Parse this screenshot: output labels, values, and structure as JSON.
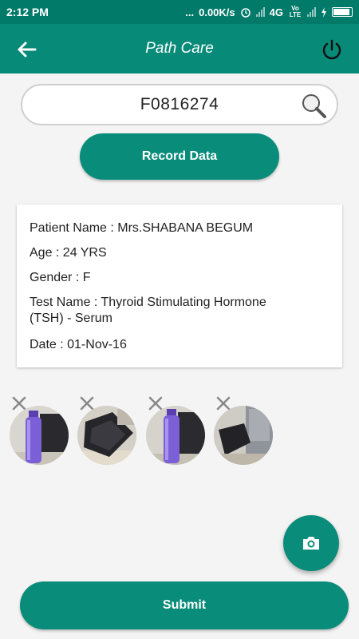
{
  "status_bar": {
    "time": "2:12 PM",
    "dots": "...",
    "network_speed": "0.00K/s",
    "network_type": "4G",
    "volte": "Vo LTE"
  },
  "app_bar": {
    "title": "Path Care",
    "back_icon": "arrow-left-icon",
    "power_icon": "power-icon"
  },
  "search": {
    "value": "F0816274",
    "icon": "magnifier-icon"
  },
  "record_button": {
    "label": "Record Data"
  },
  "patient": {
    "name_line": "Patient Name : Mrs.SHABANA BEGUM",
    "age_line": "Age : 24 YRS",
    "gender_line": "Gender : F",
    "test_line_1": "Test Name : Thyroid Stimulating Hormone",
    "test_line_2": "(TSH) - Serum",
    "date_line": "Date :  01-Nov-16"
  },
  "photos": [
    {
      "subject": "bottle",
      "remove_icon": "close-icon"
    },
    {
      "subject": "bag",
      "remove_icon": "close-icon"
    },
    {
      "subject": "bottle",
      "remove_icon": "close-icon"
    },
    {
      "subject": "bag",
      "remove_icon": "close-icon"
    }
  ],
  "camera_button": {
    "icon": "camera-icon"
  },
  "submit_button": {
    "label": "Submit"
  },
  "colors": {
    "primary": "#078a78",
    "status_bar": "#017a6a",
    "button": "#0a8c7a"
  }
}
